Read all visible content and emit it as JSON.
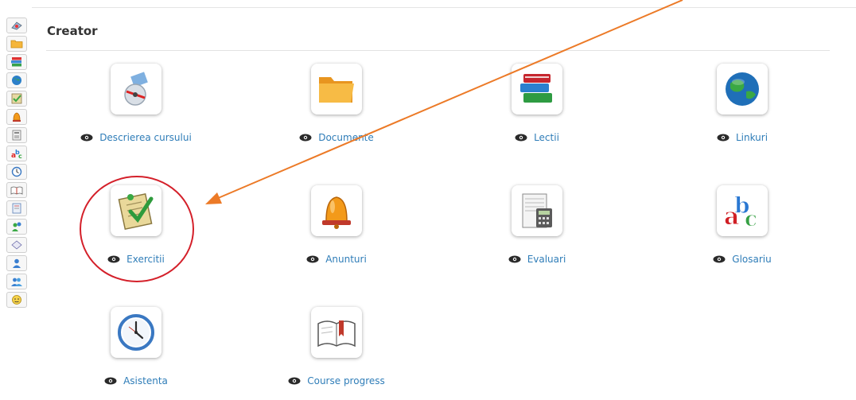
{
  "section": {
    "title": "Creator"
  },
  "sidebar": {
    "icons": [
      "course-description-icon",
      "documents-icon",
      "lessons-icon",
      "links-icon",
      "exercises-icon",
      "announcements-icon",
      "evaluations-icon",
      "glossary-icon",
      "attendance-icon",
      "course-progress-icon",
      "notebook-icon",
      "users-icon",
      "chat-icon",
      "user-icon",
      "groups-icon",
      "survey-icon"
    ]
  },
  "tools": [
    {
      "label": "Descrierea cursului",
      "icon": "course-description-icon"
    },
    {
      "label": "Documente",
      "icon": "folder-icon"
    },
    {
      "label": "Lectii",
      "icon": "books-icon"
    },
    {
      "label": "Linkuri",
      "icon": "globe-icon"
    },
    {
      "label": "Exercitii",
      "icon": "exercises-icon"
    },
    {
      "label": "Anunturi",
      "icon": "bell-icon"
    },
    {
      "label": "Evaluari",
      "icon": "calculator-icon"
    },
    {
      "label": "Glosariu",
      "icon": "abc-icon"
    },
    {
      "label": "Asistenta",
      "icon": "clock-icon"
    },
    {
      "label": "Course progress",
      "icon": "open-book-icon"
    }
  ],
  "colors": {
    "link": "#2f7db8",
    "annotation_arrow": "#ec7a27",
    "annotation_circle": "#d4202a"
  }
}
